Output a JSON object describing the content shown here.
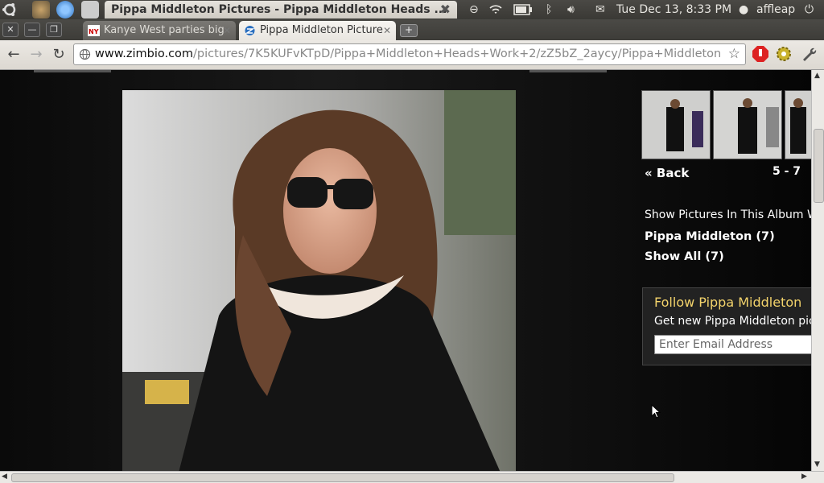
{
  "system_bar": {
    "window_title": "Pippa Middleton Pictures - Pippa Middleton Heads ...",
    "datetime": "Tue Dec 13,  8:33 PM",
    "user": "affleap"
  },
  "tabs": [
    {
      "label": "Kanye West parties big",
      "active": false
    },
    {
      "label": "Pippa Middleton Picture",
      "active": true
    }
  ],
  "address_bar": {
    "domain": "www.zimbio.com",
    "path": "/pictures/7K5KUFvKTpD/Pippa+Middleton+Heads+Work+2/zZ5bZ_2aycy/Pippa+Middleton"
  },
  "gallery": {
    "back_label": "« Back",
    "count_label": "5 - 7",
    "filter_label": "Show Pictures In This Album With",
    "filter_links": [
      "Pippa Middleton (7)",
      "Show All (7)"
    ]
  },
  "follow_box": {
    "title": "Follow Pippa Middleton",
    "description": "Get new Pippa Middleton pictures",
    "email_placeholder": "Enter Email Address"
  },
  "colors": {
    "follow_title": "#f3d36b",
    "page_bg": "#0a0a0a"
  }
}
